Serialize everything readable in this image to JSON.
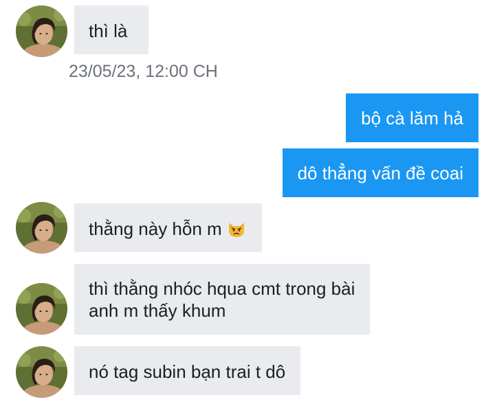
{
  "conversation": {
    "timestamp": "23/05/23, 12:00 CH",
    "messages": [
      {
        "direction": "incoming",
        "text": "thì là"
      },
      {
        "direction": "outgoing",
        "text": "bộ cà lăm hả"
      },
      {
        "direction": "outgoing",
        "text": "dô thẳng vấn đề coai"
      },
      {
        "direction": "incoming",
        "text": "thằng này hỗn m",
        "emoji": "angry-cat-face"
      },
      {
        "direction": "incoming",
        "lines": [
          "thì thằng nhóc hqua cmt trong bài",
          "anh m thấy khum"
        ]
      },
      {
        "direction": "incoming",
        "text": "nó tag subin bạn trai t dô"
      }
    ]
  },
  "colors": {
    "incoming_bubble": "#e9ebef",
    "outgoing_bubble": "#1a97f2",
    "timestamp_text": "#6b7178"
  }
}
